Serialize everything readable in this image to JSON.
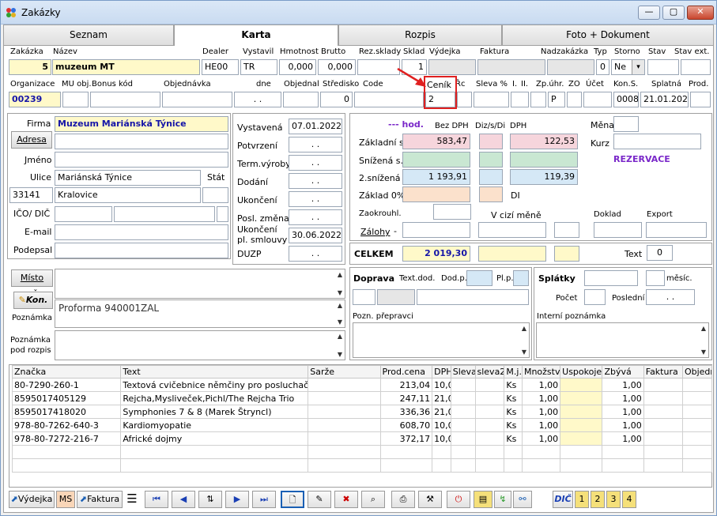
{
  "window": {
    "title": "Zakázky",
    "min": "—",
    "max": "▢",
    "close": "✕"
  },
  "tabs": [
    "Seznam",
    "Karta",
    "Rozpis",
    "Foto + Dokument"
  ],
  "header": {
    "labels": {
      "zakazka": "Zakázka",
      "nazev": "Název",
      "dealer": "Dealer",
      "vystavil": "Vystavil",
      "hmotnost": "Hmotnost",
      "brutto": "Brutto",
      "rezsklady": "Rez.sklady",
      "sklad": "Sklad",
      "vydejka": "Výdejka",
      "faktura": "Faktura",
      "nadzakazka": "Nadzakázka",
      "typ": "Typ",
      "storno": "Storno",
      "stav": "Stav",
      "stavext": "Stav ext."
    },
    "values": {
      "zakazka": "5",
      "nazev": "muzeum MT",
      "dealer": "HE00",
      "vystavil": "TR",
      "hmotnost": "0,000",
      "brutto": "0,000",
      "sklad": "1",
      "typ": "0",
      "storno": "Ne"
    }
  },
  "row2": {
    "labels": {
      "organizace": "Organizace",
      "muobj": "MU obj.",
      "bonus": "Bonus kód",
      "objednavka": "Objednávka",
      "dne": "dne",
      "objednal": "Objednal",
      "stredisko": "Středisko",
      "kod": "Code",
      "cenik": "Ceník",
      "rc": "Řc",
      "sleva": "Sleva %",
      "i": "I.",
      "ii": "II.",
      "zpuhr": "Zp.úhr.",
      "zo": "ZO",
      "ucet": "Účet",
      "kons": "Kon.S.",
      "splatna": "Splatná",
      "prod": "Prod."
    },
    "values": {
      "organizace": "00239",
      "dne": ". .",
      "stredisko": "0",
      "cenik": "2",
      "zpuhr": "P",
      "kons": "0008",
      "splatna": "21.01.2022"
    }
  },
  "firm": {
    "labels": {
      "firma": "Firma",
      "adresa": "Adresa",
      "jmeno": "Jméno",
      "ulice": "Ulice",
      "stat": "Stát",
      "ico": "IČO/ DIČ",
      "email": "E-mail",
      "podepsal": "Podepsal"
    },
    "values": {
      "firma": "Muzeum  Mariánská Týnice",
      "ulice": "Mariánská Týnice",
      "psc": "33141",
      "mesto": "Kralovice"
    }
  },
  "dates": {
    "labels": [
      "Vystavená",
      "Potvrzení",
      "Term.výroby",
      "Dodání",
      "Ukončení",
      "Posl. změna",
      "Ukončení pl. smlouvy",
      "DUZP"
    ],
    "values": [
      "07.01.2022",
      ". .",
      ". .",
      ". .",
      ". .",
      ". .",
      "30.06.2022",
      ". ."
    ]
  },
  "prices": {
    "hod": "--- hod.",
    "bezdph": "Bez DPH",
    "dizsdi": "Diz/s/Di",
    "dph": "DPH",
    "rows": [
      "Základní s.",
      "Snížená s.",
      "2.snížená",
      "Základ 0%"
    ],
    "zakladni": {
      "bez": "583,47",
      "dph": "122,53"
    },
    "snizena2": {
      "bez": "1 193,91",
      "dph": "119,39"
    },
    "di": "DI",
    "zaokrouhl": "Zaokrouhl.",
    "zalohy": "Zálohy",
    "vcizi": "V cizí měně",
    "doklad": "Doklad",
    "export": "Export",
    "mena": "Měna",
    "kurz": "Kurz",
    "rezervace": "REZERVACE",
    "celkem": "CELKEM",
    "celkem_val": "2 019,30",
    "text": "Text",
    "text_val": "0"
  },
  "doprava": {
    "doprava": "Doprava",
    "textdod": "Text.dod.",
    "dodp": "Dod.p.",
    "plp": "Pl.p.",
    "splatky": "Splátky",
    "mesic": "měsíc.",
    "pocet": "Počet",
    "posledni": "Poslední",
    "posledni_val": ". .",
    "pozn": "Pozn. přepravci",
    "interni": "Interní poznámka"
  },
  "left_lower": {
    "misto": "Místo urč.",
    "kon": "Kon.",
    "poznamka": "Poznámka",
    "poznamka_rozpis": "Poznámka pod rozpis",
    "proforma": "Proforma 940001ZAL"
  },
  "grid": {
    "columns": [
      "Značka",
      "Text",
      "Sarže",
      "Prod.cena",
      "DPH",
      "Sleva",
      "sleva2",
      "M.j.",
      "Množství",
      "Uspokojeno",
      "Zbývá",
      "Faktura",
      "Objedn"
    ],
    "rows": [
      [
        "80-7290-260-1",
        "Textová cvičebnice němčiny pro posluchače Pe",
        "",
        "213,04",
        "10,0",
        "",
        "",
        "Ks",
        "1,00",
        "",
        "1,00",
        "",
        ""
      ],
      [
        "8595017405129",
        "Rejcha,Mysliveček,Pichl/The Rejcha Trio",
        "",
        "247,11",
        "21,0",
        "",
        "",
        "Ks",
        "1,00",
        "",
        "1,00",
        "",
        ""
      ],
      [
        "8595017418020",
        "Symphonies 7 & 8 (Marek Štryncl)",
        "",
        "336,36",
        "21,0",
        "",
        "",
        "Ks",
        "1,00",
        "",
        "1,00",
        "",
        ""
      ],
      [
        "978-80-7262-640-3",
        "Kardiomyopatie",
        "",
        "608,70",
        "10,0",
        "",
        "",
        "Ks",
        "1,00",
        "",
        "1,00",
        "",
        ""
      ],
      [
        "978-80-7272-216-7",
        "Africké dojmy",
        "",
        "372,17",
        "10,0",
        "",
        "",
        "Ks",
        "1,00",
        "",
        "1,00",
        "",
        ""
      ]
    ]
  },
  "toolbar": {
    "vydejka": "Výdejka",
    "ms": "MS",
    "faktura": "Faktura",
    "dic": "DIČ"
  },
  "colors": {
    "accent": "#1515a8",
    "highlight": "#e02020",
    "yellow": "#fff9c9",
    "rezervace": "#7a28c9"
  }
}
